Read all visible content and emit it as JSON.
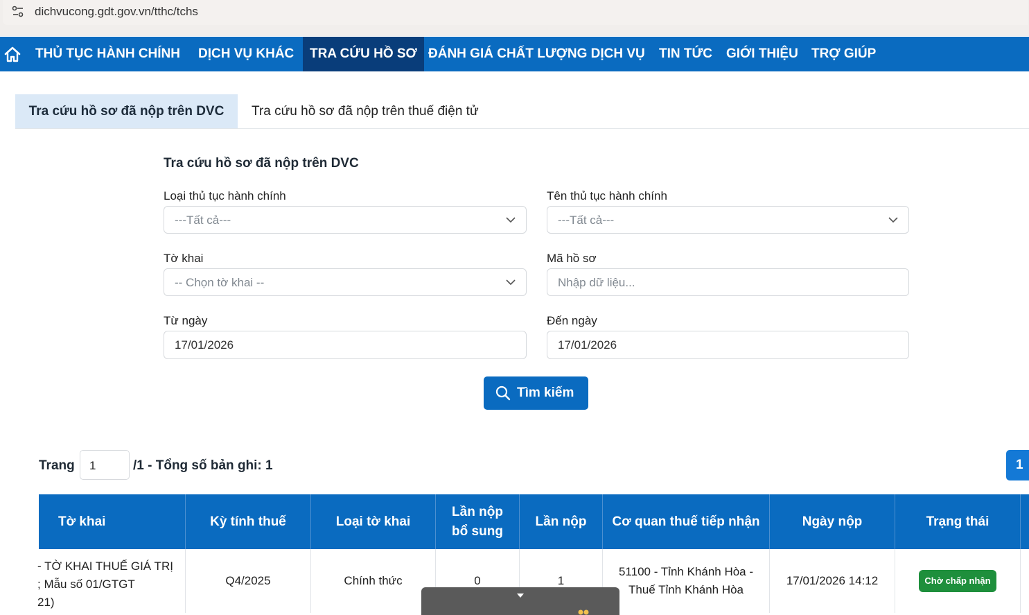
{
  "browser": {
    "url": "dichvucong.gdt.gov.vn/tthc/tchs"
  },
  "nav": {
    "items": [
      {
        "label": "THỦ TỤC HÀNH CHÍNH"
      },
      {
        "label": "DỊCH VỤ KHÁC"
      },
      {
        "label": "TRA CỨU HỒ SƠ"
      },
      {
        "label": "ĐÁNH GIÁ CHẤT LƯỢNG DỊCH VỤ"
      },
      {
        "label": "TIN TỨC"
      },
      {
        "label": "GIỚI THIỆU"
      },
      {
        "label": "TRỢ GIÚP"
      }
    ],
    "active": "TRA CỨU HỒ SƠ"
  },
  "tabs": [
    {
      "label": "Tra cứu hồ sơ đã nộp trên DVC"
    },
    {
      "label": "Tra cứu hồ sơ đã nộp trên thuế điện tử"
    }
  ],
  "form": {
    "title": "Tra cứu hồ sơ đã nộp trên DVC",
    "loai_label": "Loại thủ tục hành chính",
    "loai_value": "---Tất cả---",
    "ten_label": "Tên thủ tục hành chính",
    "ten_value": "---Tất cả---",
    "tokhai_label": "Tờ khai",
    "tokhai_value": "-- Chọn tờ khai --",
    "mahoso_label": "Mã hồ sơ",
    "mahoso_placeholder": "Nhập dữ liệu...",
    "tungay_label": "Từ ngày",
    "tungay_value": "17/01/2026",
    "denngay_label": "Đến ngày",
    "denngay_value": "17/01/2026",
    "search_label": "Tìm kiếm"
  },
  "pagination": {
    "page_label": "Trang",
    "page_value": "1",
    "summary": "/1 - Tổng số bản ghi: 1",
    "page_button": "1"
  },
  "table": {
    "headers": [
      "Tờ khai",
      "Kỳ tính thuế",
      "Loại tờ khai",
      "Lần nộp bổ sung",
      "Lần nộp",
      "Cơ quan thuế tiếp nhận",
      "Ngày nộp",
      "Trạng thái"
    ],
    "header_lan_nop_bo_sung_line1": "Lần nộp",
    "header_lan_nop_bo_sung_line2": "bổ sung",
    "rows": [
      {
        "to_khai_line1": "- TỜ KHAI THUẾ GIÁ TRỊ",
        "to_khai_line2": "; Mẫu số 01/GTGT",
        "to_khai_line3": "21)",
        "ky_tinh_thue": "Q4/2025",
        "loai_to_khai": "Chính thức",
        "lan_nop_bo_sung": "0",
        "lan_nop": "1",
        "co_quan_line1": "51100 - Tỉnh Khánh Hòa -",
        "co_quan_line2": "Thuế Tỉnh Khánh Hòa",
        "ngay_nop": "17/01/2026 14:12",
        "trang_thai": "Chờ chấp nhận"
      }
    ]
  },
  "colors": {
    "primary": "#0a6bc0",
    "nav_active": "#093d7a",
    "tab_active_bg": "#dbe9f7",
    "badge": "#1e8f3c"
  }
}
